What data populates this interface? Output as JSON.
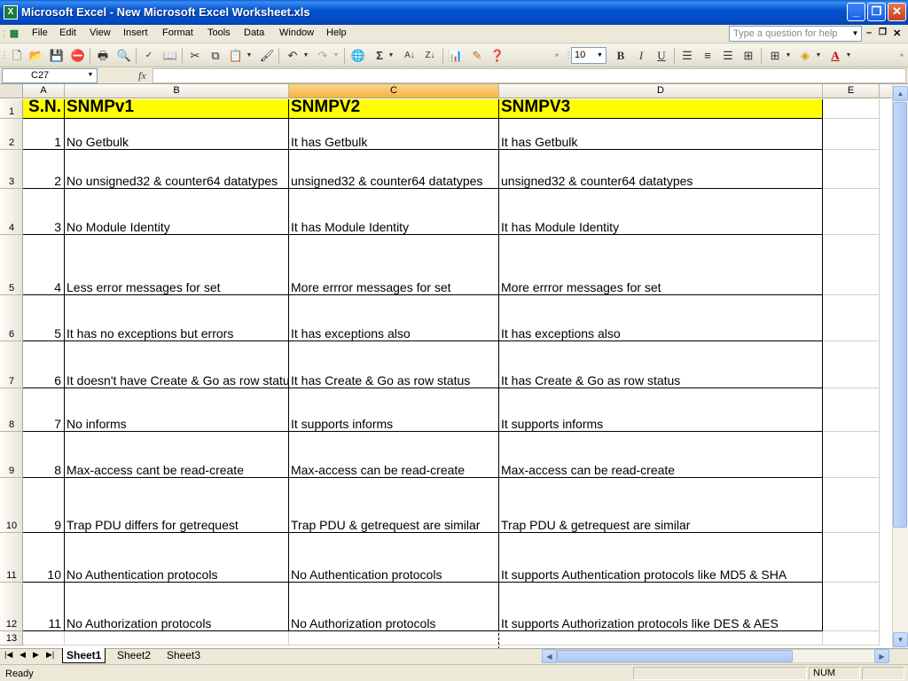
{
  "window": {
    "title": "Microsoft Excel - New Microsoft Excel Worksheet.xls",
    "app_icon": "X",
    "minimize": "_",
    "restore": "❐",
    "close": "✕"
  },
  "menu": {
    "items": [
      "File",
      "Edit",
      "View",
      "Insert",
      "Format",
      "Tools",
      "Data",
      "Window",
      "Help"
    ],
    "help_placeholder": "Type a question for help",
    "doc_minimize": "–",
    "doc_restore": "❐",
    "doc_close": "✕"
  },
  "toolbar": {
    "font_size": "10",
    "bold": "B",
    "italic": "I",
    "underline": "U"
  },
  "formula": {
    "name_box": "C27",
    "fx": "fx",
    "value": ""
  },
  "sheet": {
    "columns": [
      "A",
      "B",
      "C",
      "D",
      "E"
    ],
    "active_column": "C",
    "header_row": {
      "row": "1",
      "a": "S.N.",
      "b": "SNMPv1",
      "c": "SNMPV2",
      "d": "SNMPV3"
    },
    "rows": [
      {
        "row": "2",
        "a": "1",
        "b": "No Getbulk",
        "c": "It has Getbulk",
        "d": "It has Getbulk"
      },
      {
        "row": "3",
        "a": "2",
        "b": "No unsigned32 & counter64 datatypes",
        "c": "unsigned32 & counter64 datatypes",
        "d": "unsigned32 & counter64 datatypes"
      },
      {
        "row": "4",
        "a": "3",
        "b": "No Module Identity",
        "c": "It has Module Identity",
        "d": "It has Module Identity"
      },
      {
        "row": "5",
        "a": "4",
        "b": "Less error messages for set",
        "c": "More errror messages for set",
        "d": "More errror messages for set"
      },
      {
        "row": "6",
        "a": "5",
        "b": "It has no exceptions but errors",
        "c": "It has exceptions also",
        "d": "It has exceptions also"
      },
      {
        "row": "7",
        "a": "6",
        "b": "It doesn't have Create & Go as row status",
        "c": "It has Create & Go as row status",
        "d": "It has Create & Go as row status"
      },
      {
        "row": "8",
        "a": "7",
        "b": "No informs",
        "c": "It supports informs",
        "d": "It supports informs"
      },
      {
        "row": "9",
        "a": "8",
        "b": "Max-access cant be read-create",
        "c": "Max-access can be read-create",
        "d": "Max-access can be read-create"
      },
      {
        "row": "10",
        "a": "9",
        "b": "Trap PDU differs for getrequest",
        "c": "Trap PDU & getrequest are similar",
        "d": "Trap PDU & getrequest are similar"
      },
      {
        "row": "11",
        "a": "10",
        "b": "No Authentication protocols",
        "c": "No Authentication protocols",
        "d": "It supports Authentication protocols like MD5 & SHA"
      },
      {
        "row": "12",
        "a": "11",
        "b": "No Authorization protocols",
        "c": "No Authorization protocols",
        "d": "It supports Authorization protocols like DES & AES"
      }
    ],
    "last_row": "13"
  },
  "tabs": {
    "sheets": [
      "Sheet1",
      "Sheet2",
      "Sheet3"
    ],
    "active": "Sheet1"
  },
  "status": {
    "text": "Ready",
    "num": "NUM"
  },
  "colors": {
    "header_fill": "#ffff00",
    "active_column_header": "#f4b440",
    "titlebar": "#0554d0"
  }
}
